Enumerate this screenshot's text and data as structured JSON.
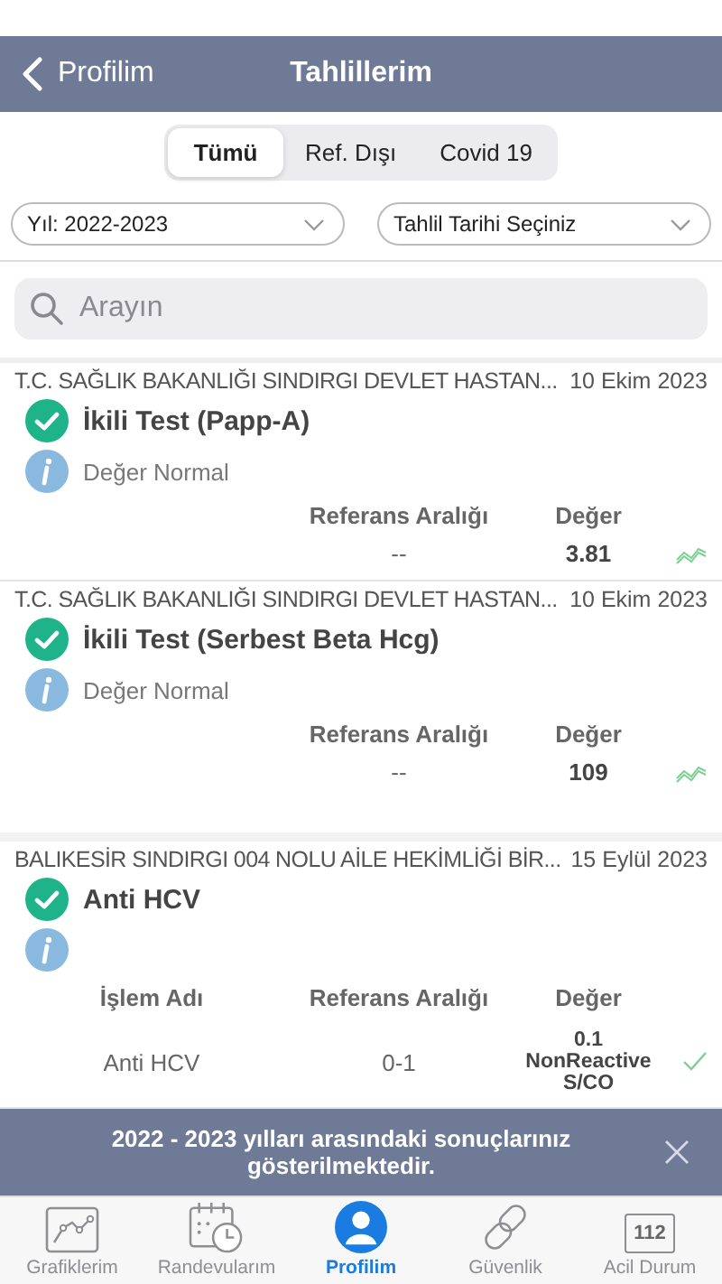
{
  "nav_bar": {
    "back_label": "Profilim",
    "title": "Tahlillerim"
  },
  "segments": [
    {
      "label": "Tümü",
      "selected": true
    },
    {
      "label": "Ref. Dışı",
      "selected": false
    },
    {
      "label": "Covid 19",
      "selected": false
    }
  ],
  "filters": [
    {
      "value": "Yıl: 2022-2023"
    },
    {
      "value": "Tahlil Tarihi Seçiniz"
    }
  ],
  "search": {
    "placeholder": "Arayın"
  },
  "results": [
    {
      "institution": "T.C. SAĞLIK BAKANLIĞI SINDIRGI DEVLET HASTAN...",
      "date": "10 Ekim 2023",
      "test": "İkili Test (Papp-A)",
      "note": "Değer Normal",
      "columns": [
        "Referans Aralığı",
        "Değer"
      ],
      "rows": [
        {
          "reference": "--",
          "value": "3.81",
          "kind": "trend"
        }
      ]
    },
    {
      "institution": "T.C. SAĞLIK BAKANLIĞI SINDIRGI DEVLET HASTAN...",
      "date": "10 Ekim 2023",
      "test": "İkili Test (Serbest Beta Hcg)",
      "note": "Değer Normal",
      "columns": [
        "Referans Aralığı",
        "Değer"
      ],
      "rows": [
        {
          "reference": "--",
          "value": "109",
          "kind": "trend"
        }
      ]
    },
    {
      "institution": "BALIKESİR SINDIRGI 004 NOLU AİLE HEKİMLİĞİ BİR...",
      "date": "15 Eylül 2023",
      "test": "Anti HCV",
      "columns": [
        "İşlem Adı",
        "Referans Aralığı",
        "Değer"
      ],
      "rows": [
        {
          "name": "Anti HCV",
          "reference": "0-1",
          "value": "0.1 NonReactive S/CO",
          "kind": "check"
        }
      ]
    }
  ],
  "banner": {
    "message": "2022 - 2023 yılları arasındaki sonuçlarınız gösterilmektedir."
  },
  "tab_bar": [
    {
      "label": "Grafiklerim",
      "kind": "chart",
      "selected": false
    },
    {
      "label": "Randevularım",
      "kind": "calendar",
      "selected": false
    },
    {
      "label": "Profilim",
      "kind": "person",
      "selected": true
    },
    {
      "label": "Güvenlik",
      "kind": "link",
      "selected": false
    },
    {
      "label": "Acil Durum",
      "kind": "emergency",
      "badge": "112",
      "selected": false
    }
  ]
}
